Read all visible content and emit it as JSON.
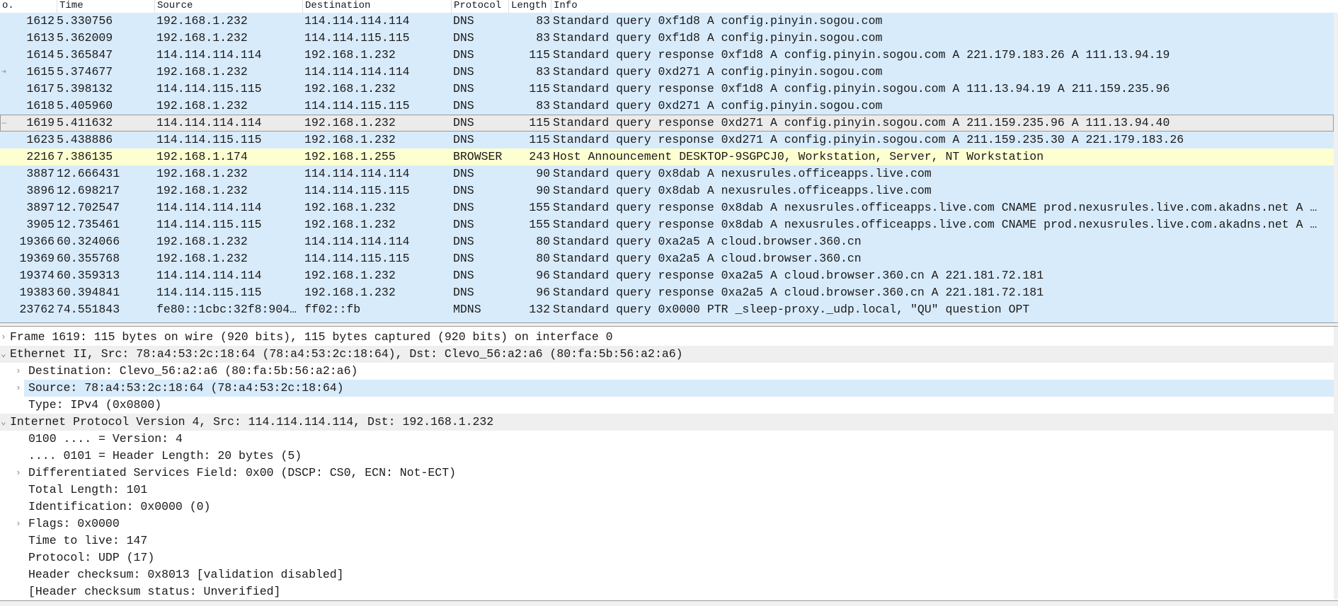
{
  "columns": {
    "no": "o.",
    "time": "Time",
    "source": "Source",
    "destination": "Destination",
    "protocol": "Protocol",
    "length": "Length",
    "info": "Info"
  },
  "colors": {
    "dns_row": "#d8ebfb",
    "browser_row": "#feffd1",
    "selected_row": "#ebebeb"
  },
  "packets": [
    {
      "no": "1612",
      "time": "5.330756",
      "source": "192.168.1.232",
      "destination": "114.114.114.114",
      "protocol": "DNS",
      "length": "83",
      "info": "Standard query 0xf1d8 A config.pinyin.sogou.com"
    },
    {
      "no": "1613",
      "time": "5.362009",
      "source": "192.168.1.232",
      "destination": "114.114.115.115",
      "protocol": "DNS",
      "length": "83",
      "info": "Standard query 0xf1d8 A config.pinyin.sogou.com"
    },
    {
      "no": "1614",
      "time": "5.365847",
      "source": "114.114.114.114",
      "destination": "192.168.1.232",
      "protocol": "DNS",
      "length": "115",
      "info": "Standard query response 0xf1d8 A config.pinyin.sogou.com A 221.179.183.26 A 111.13.94.19"
    },
    {
      "no": "1615",
      "time": "5.374677",
      "source": "192.168.1.232",
      "destination": "114.114.114.114",
      "protocol": "DNS",
      "length": "83",
      "info": "Standard query 0xd271 A config.pinyin.sogou.com",
      "marker": "arrow-right-icon"
    },
    {
      "no": "1617",
      "time": "5.398132",
      "source": "114.114.115.115",
      "destination": "192.168.1.232",
      "protocol": "DNS",
      "length": "115",
      "info": "Standard query response 0xf1d8 A config.pinyin.sogou.com A 111.13.94.19 A 211.159.235.96"
    },
    {
      "no": "1618",
      "time": "5.405960",
      "source": "192.168.1.232",
      "destination": "114.114.115.115",
      "protocol": "DNS",
      "length": "83",
      "info": "Standard query 0xd271 A config.pinyin.sogou.com"
    },
    {
      "no": "1619",
      "time": "5.411632",
      "source": "114.114.114.114",
      "destination": "192.168.1.232",
      "protocol": "DNS",
      "length": "115",
      "info": "Standard query response 0xd271 A config.pinyin.sogou.com A 211.159.235.96 A 111.13.94.40",
      "selected": true,
      "marker": "dash-icon"
    },
    {
      "no": "1623",
      "time": "5.438886",
      "source": "114.114.115.115",
      "destination": "192.168.1.232",
      "protocol": "DNS",
      "length": "115",
      "info": "Standard query response 0xd271 A config.pinyin.sogou.com A 211.159.235.30 A 221.179.183.26"
    },
    {
      "no": "2216",
      "time": "7.386135",
      "source": "192.168.1.174",
      "destination": "192.168.1.255",
      "protocol": "BROWSER",
      "length": "243",
      "info": "Host Announcement DESKTOP-9SGPCJ0, Workstation, Server, NT Workstation"
    },
    {
      "no": "3887",
      "time": "12.666431",
      "source": "192.168.1.232",
      "destination": "114.114.114.114",
      "protocol": "DNS",
      "length": "90",
      "info": "Standard query 0x8dab A nexusrules.officeapps.live.com"
    },
    {
      "no": "3896",
      "time": "12.698217",
      "source": "192.168.1.232",
      "destination": "114.114.115.115",
      "protocol": "DNS",
      "length": "90",
      "info": "Standard query 0x8dab A nexusrules.officeapps.live.com"
    },
    {
      "no": "3897",
      "time": "12.702547",
      "source": "114.114.114.114",
      "destination": "192.168.1.232",
      "protocol": "DNS",
      "length": "155",
      "info": "Standard query response 0x8dab A nexusrules.officeapps.live.com CNAME prod.nexusrules.live.com.akadns.net A …"
    },
    {
      "no": "3905",
      "time": "12.735461",
      "source": "114.114.115.115",
      "destination": "192.168.1.232",
      "protocol": "DNS",
      "length": "155",
      "info": "Standard query response 0x8dab A nexusrules.officeapps.live.com CNAME prod.nexusrules.live.com.akadns.net A …"
    },
    {
      "no": "19366",
      "time": "60.324066",
      "source": "192.168.1.232",
      "destination": "114.114.114.114",
      "protocol": "DNS",
      "length": "80",
      "info": "Standard query 0xa2a5 A cloud.browser.360.cn"
    },
    {
      "no": "19369",
      "time": "60.355768",
      "source": "192.168.1.232",
      "destination": "114.114.115.115",
      "protocol": "DNS",
      "length": "80",
      "info": "Standard query 0xa2a5 A cloud.browser.360.cn"
    },
    {
      "no": "19374",
      "time": "60.359313",
      "source": "114.114.114.114",
      "destination": "192.168.1.232",
      "protocol": "DNS",
      "length": "96",
      "info": "Standard query response 0xa2a5 A cloud.browser.360.cn A 221.181.72.181"
    },
    {
      "no": "19383",
      "time": "60.394841",
      "source": "114.114.115.115",
      "destination": "192.168.1.232",
      "protocol": "DNS",
      "length": "96",
      "info": "Standard query response 0xa2a5 A cloud.browser.360.cn A 221.181.72.181"
    },
    {
      "no": "23762",
      "time": "74.551843",
      "source": "fe80::1cbc:32f8:904…",
      "destination": "ff02::fb",
      "protocol": "MDNS",
      "length": "132",
      "info": "Standard query 0x0000 PTR _sleep-proxy._udp.local, \"QU\" question OPT"
    }
  ],
  "details": [
    {
      "level": 0,
      "arrow": "collapsed",
      "text": "Frame 1619: 115 bytes on wire (920 bits), 115 bytes captured (920 bits) on interface 0"
    },
    {
      "level": 0,
      "arrow": "expanded",
      "text": "Ethernet II, Src: 78:a4:53:2c:18:64 (78:a4:53:2c:18:64), Dst: Clevo_56:a2:a6 (80:fa:5b:56:a2:a6)"
    },
    {
      "level": 1,
      "arrow": "collapsed",
      "text": "Destination: Clevo_56:a2:a6 (80:fa:5b:56:a2:a6)"
    },
    {
      "level": 1,
      "arrow": "collapsed",
      "text": "Source: 78:a4:53:2c:18:64 (78:a4:53:2c:18:64)",
      "highlighted": true
    },
    {
      "level": 1,
      "arrow": "none",
      "text": "Type: IPv4 (0x0800)"
    },
    {
      "level": 0,
      "arrow": "expanded",
      "text": "Internet Protocol Version 4, Src: 114.114.114.114, Dst: 192.168.1.232"
    },
    {
      "level": 1,
      "arrow": "none",
      "text": "0100 .... = Version: 4"
    },
    {
      "level": 1,
      "arrow": "none",
      "text": ".... 0101 = Header Length: 20 bytes (5)"
    },
    {
      "level": 1,
      "arrow": "collapsed",
      "text": "Differentiated Services Field: 0x00 (DSCP: CS0, ECN: Not-ECT)"
    },
    {
      "level": 1,
      "arrow": "none",
      "text": "Total Length: 101"
    },
    {
      "level": 1,
      "arrow": "none",
      "text": "Identification: 0x0000 (0)"
    },
    {
      "level": 1,
      "arrow": "collapsed",
      "text": "Flags: 0x0000"
    },
    {
      "level": 1,
      "arrow": "none",
      "text": "Time to live: 147"
    },
    {
      "level": 1,
      "arrow": "none",
      "text": "Protocol: UDP (17)"
    },
    {
      "level": 1,
      "arrow": "none",
      "text": "Header checksum: 0x8013 [validation disabled]"
    },
    {
      "level": 1,
      "arrow": "none",
      "text": "[Header checksum status: Unverified]"
    }
  ]
}
